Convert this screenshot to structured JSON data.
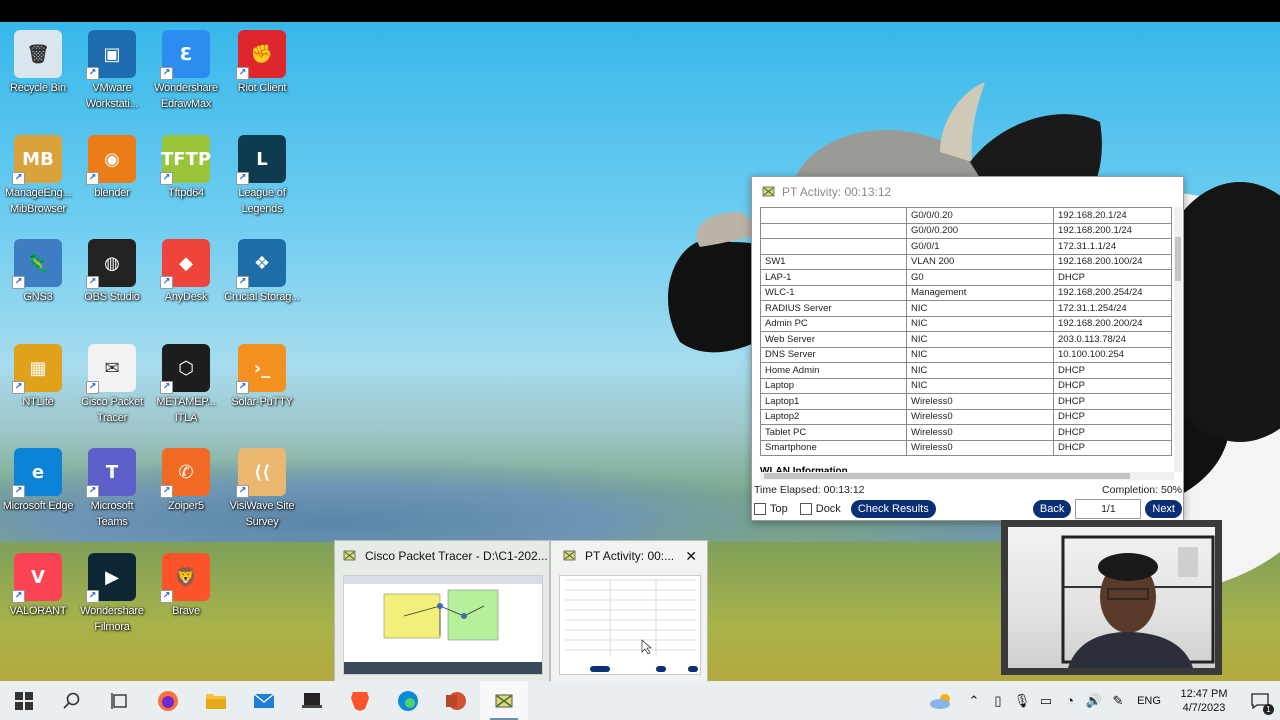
{
  "desktop_icons": [
    {
      "label": "Recycle Bin",
      "color": "#d9e6ee",
      "glyph": "🗑",
      "shortcut": false
    },
    {
      "label": "VMware Workstati...",
      "color": "#1d6cb0",
      "glyph": "▣",
      "shortcut": true
    },
    {
      "label": "Wondershare EdrawMax",
      "color": "#2d8cf0",
      "glyph": "Ɛ",
      "shortcut": true
    },
    {
      "label": "Riot Client",
      "color": "#e0262d",
      "glyph": "✊",
      "shortcut": true
    },
    {
      "label": "ManageEng... MibBrowser",
      "color": "#d9a23b",
      "glyph": "MB",
      "shortcut": true
    },
    {
      "label": "blender",
      "color": "#eb7d16",
      "glyph": "◉",
      "shortcut": true
    },
    {
      "label": "Tftpd64",
      "color": "#9ac43a",
      "glyph": "TFTP",
      "shortcut": true
    },
    {
      "label": "League of Legends",
      "color": "#0f3b4f",
      "glyph": "L",
      "shortcut": true
    },
    {
      "label": "GNS3",
      "color": "#3e7cc4",
      "glyph": "🦎",
      "shortcut": true
    },
    {
      "label": "OBS Studio",
      "color": "#222222",
      "glyph": "◍",
      "shortcut": true
    },
    {
      "label": "AnyDesk",
      "color": "#ef443b",
      "glyph": "◆",
      "shortcut": true
    },
    {
      "label": "Crucial Storag...",
      "color": "#1b6ea6",
      "glyph": "❖",
      "shortcut": true
    },
    {
      "label": "NTLite",
      "color": "#e0a21a",
      "glyph": "▦",
      "shortcut": true
    },
    {
      "label": "Cisco Packet Tracer",
      "color": "#f2f2f2",
      "glyph": "✉",
      "shortcut": true
    },
    {
      "label": "METAMEP... ITLA",
      "color": "#1d1d1d",
      "glyph": "⬡",
      "shortcut": true
    },
    {
      "label": "Solar-PuTTY",
      "color": "#f29120",
      "glyph": "›_",
      "shortcut": true
    },
    {
      "label": "Microsoft Edge",
      "color": "#0b84d8",
      "glyph": "e",
      "shortcut": true
    },
    {
      "label": "Microsoft Teams",
      "color": "#5b5fc7",
      "glyph": "T",
      "shortcut": true
    },
    {
      "label": "Zoiper5",
      "color": "#f06a24",
      "glyph": "✆",
      "shortcut": true
    },
    {
      "label": "VisiWave Site Survey",
      "color": "#e9b770",
      "glyph": "⟨⟨",
      "shortcut": true
    },
    {
      "label": "VALORANT",
      "color": "#fa4454",
      "glyph": "V",
      "shortcut": true
    },
    {
      "label": "Wondershare Filmora",
      "color": "#0e2735",
      "glyph": "▶",
      "shortcut": true
    },
    {
      "label": "Brave",
      "color": "#fb542b",
      "glyph": "🦁",
      "shortcut": true
    }
  ],
  "pt_activity": {
    "title": "PT Activity: 00:13:12",
    "table_rows": [
      [
        "",
        "G0/0/0.20",
        "192.168.20.1/24"
      ],
      [
        "",
        "G0/0/0.200",
        "192.168.200.1/24"
      ],
      [
        "",
        "G0/0/1",
        "172.31.1.1/24"
      ],
      [
        "SW1",
        "VLAN 200",
        "192.168.200.100/24"
      ],
      [
        "LAP-1",
        "G0",
        "DHCP"
      ],
      [
        "WLC-1",
        "Management",
        "192.168.200.254/24"
      ],
      [
        "RADIUS Server",
        "NIC",
        "172.31.1.254/24"
      ],
      [
        "Admin PC",
        "NIC",
        "192.168.200.200/24"
      ],
      [
        "Web Server",
        "NIC",
        "203.0.113.78/24"
      ],
      [
        "DNS Server",
        "NIC",
        "10.100.100.254"
      ],
      [
        "Home Admin",
        "NIC",
        "DHCP"
      ],
      [
        "Laptop",
        "NIC",
        "DHCP"
      ],
      [
        "Laptop1",
        "Wireless0",
        "DHCP"
      ],
      [
        "Laptop2",
        "Wireless0",
        "DHCP"
      ],
      [
        "Tablet PC",
        "Wireless0",
        "DHCP"
      ],
      [
        "Smartphone",
        "Wireless0",
        "DHCP"
      ]
    ],
    "section_heading": "WLAN Information",
    "time_elapsed": "Time Elapsed: 00:13:12",
    "completion": "Completion: 50%",
    "top_label": "Top",
    "dock_label": "Dock",
    "check_results": "Check Results",
    "back": "Back",
    "page": "1/1",
    "next": "Next"
  },
  "previews": {
    "packet_tracer_title": "Cisco Packet Tracer - D:\\C1-202...",
    "pt_activity_title": "PT Activity: 00:...",
    "close_glyph": "✕"
  },
  "taskbar": {
    "language": "ENG",
    "time": "12:47 PM",
    "date": "4/7/2023",
    "notification_count": "1"
  }
}
